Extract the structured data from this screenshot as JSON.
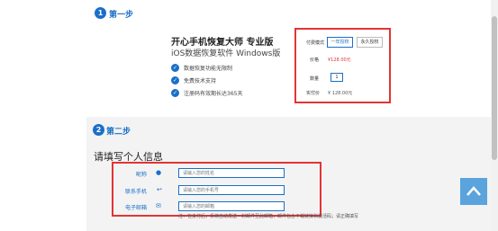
{
  "step1": {
    "number": "1",
    "title": "第一步"
  },
  "product": {
    "title": "开心手机恢复大师 专业版",
    "subtitle": "iOS数据恢复软件 Windows版",
    "features": [
      "数据恢复功能无限制",
      "免费技术支持",
      "注册码有效期长达365天"
    ]
  },
  "purchase": {
    "plan_label": "付费模式",
    "plan_options": [
      "一年授权",
      "永久授权"
    ],
    "price_label": "价格",
    "price_value": "¥128.00元",
    "qty_label": "数量",
    "qty_value": "1",
    "paid_label": "实付价",
    "paid_value": "¥ 128.00元"
  },
  "step2": {
    "number": "2",
    "title": "第二步"
  },
  "info": {
    "heading": "请填写个人信息",
    "fields": [
      {
        "label": "昵称",
        "icon": "person-icon",
        "placeholder": "请输入您的姓名"
      },
      {
        "label": "联系手机",
        "icon": "phone-icon",
        "placeholder": "请输入您的手机号"
      },
      {
        "label": "电子邮箱",
        "icon": "mail-icon",
        "placeholder": "请输入您的邮箱"
      }
    ],
    "note": "注：在支付后，系统自动发送一封邮件至此邮箱，邮件包含下载链接和激活码；请正确填写"
  },
  "colors": {
    "accent": "#1a6fc8",
    "highlight": "#e23434",
    "scrolltop": "#5aa3dc"
  }
}
